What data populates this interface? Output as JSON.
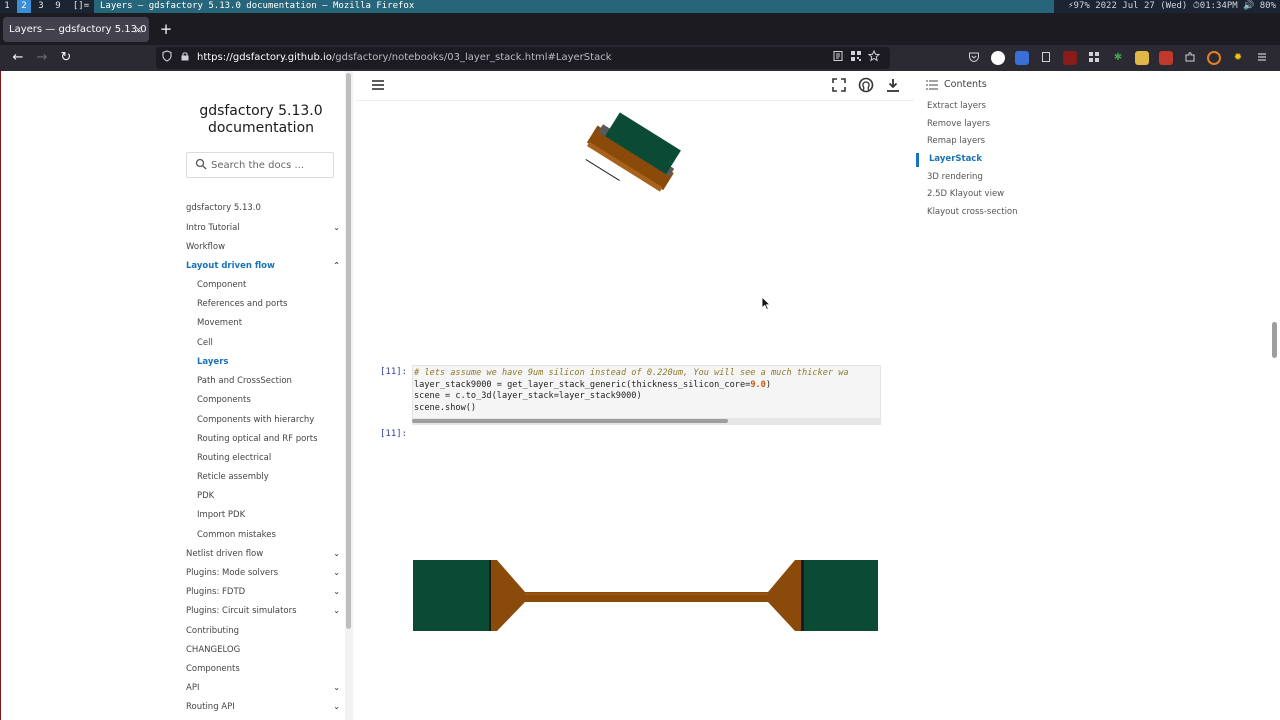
{
  "system_bar": {
    "workspaces": [
      "1",
      "2",
      "3",
      "9",
      "[]="
    ],
    "active_workspace": "2",
    "window_title": "Layers — gdsfactory 5.13.0 documentation — Mozilla Firefox",
    "status": "⚡97% 2022 Jul 27 (Wed) ⏱01:34PM 🔊 80%"
  },
  "browser": {
    "tab_title": "Layers — gdsfactory 5.13.0",
    "tab_close": "×",
    "new_tab": "+",
    "url_host": "https://gdsfactory.github.io",
    "url_path": "/gdsfactory/notebooks/03_layer_stack.html#LayerStack",
    "nav_back": "←",
    "nav_forward": "→",
    "nav_reload": "↻"
  },
  "sidebar": {
    "site_title": "gdsfactory 5.13.0 documentation",
    "search_placeholder": "Search the docs ...",
    "items": [
      {
        "label": "gdsfactory 5.13.0",
        "level": 0
      },
      {
        "label": "Intro Tutorial",
        "level": 0,
        "chevron": "⌄"
      },
      {
        "label": "Workflow",
        "level": 0
      },
      {
        "label": "Layout driven flow",
        "level": 0,
        "chevron": "⌃",
        "active": true
      },
      {
        "label": "Component",
        "level": 1
      },
      {
        "label": "References and ports",
        "level": 1
      },
      {
        "label": "Movement",
        "level": 1
      },
      {
        "label": "Cell",
        "level": 1
      },
      {
        "label": "Layers",
        "level": 1,
        "current": true
      },
      {
        "label": "Path and CrossSection",
        "level": 1
      },
      {
        "label": "Components",
        "level": 1
      },
      {
        "label": "Components with hierarchy",
        "level": 1
      },
      {
        "label": "Routing optical and RF ports",
        "level": 1
      },
      {
        "label": "Routing electrical",
        "level": 1
      },
      {
        "label": "Reticle assembly",
        "level": 1
      },
      {
        "label": "PDK",
        "level": 1
      },
      {
        "label": "Import PDK",
        "level": 1
      },
      {
        "label": "Common mistakes",
        "level": 1
      },
      {
        "label": "Netlist driven flow",
        "level": 0,
        "chevron": "⌄"
      },
      {
        "label": "Plugins: Mode solvers",
        "level": 0,
        "chevron": "⌄"
      },
      {
        "label": "Plugins: FDTD",
        "level": 0,
        "chevron": "⌄"
      },
      {
        "label": "Plugins: Circuit simulators",
        "level": 0,
        "chevron": "⌄"
      },
      {
        "label": "Contributing",
        "level": 0
      },
      {
        "label": "CHANGELOG",
        "level": 0
      },
      {
        "label": "Components",
        "level": 0
      },
      {
        "label": "API",
        "level": 0,
        "chevron": "⌄"
      },
      {
        "label": "Routing API",
        "level": 0,
        "chevron": "⌄"
      }
    ]
  },
  "notebook": {
    "in_prompt": "[11]:",
    "out_prompt": "[11]:",
    "code_comment": "# lets assume we have 9um silicon instead of 0.220um, You will see a much thicker wa",
    "code_line2_a": "layer_stack9000 = get_layer_stack_generic(thickness_silicon_core=",
    "code_line2_num": "9.0",
    "code_line2_b": ")",
    "code_line3": "scene = c.to_3d(layer_stack=layer_stack9000)",
    "code_line4": "scene.show()"
  },
  "toc": {
    "heading": "Contents",
    "items": [
      {
        "label": "Extract layers"
      },
      {
        "label": "Remove layers"
      },
      {
        "label": "Remap layers"
      },
      {
        "label": "LayerStack",
        "current": true
      },
      {
        "label": "3D rendering"
      },
      {
        "label": "2.5D Klayout view"
      },
      {
        "label": "Klayout cross-section"
      }
    ]
  },
  "colors": {
    "accent": "#1a73b8",
    "render_green": "#0b4b35",
    "render_brown": "#8a4a0a"
  },
  "icons": {
    "menu": "hamburger-icon",
    "fullscreen": "fullscreen-icon",
    "github": "github-icon",
    "download": "download-icon",
    "search": "search-icon",
    "contents": "list-icon"
  }
}
